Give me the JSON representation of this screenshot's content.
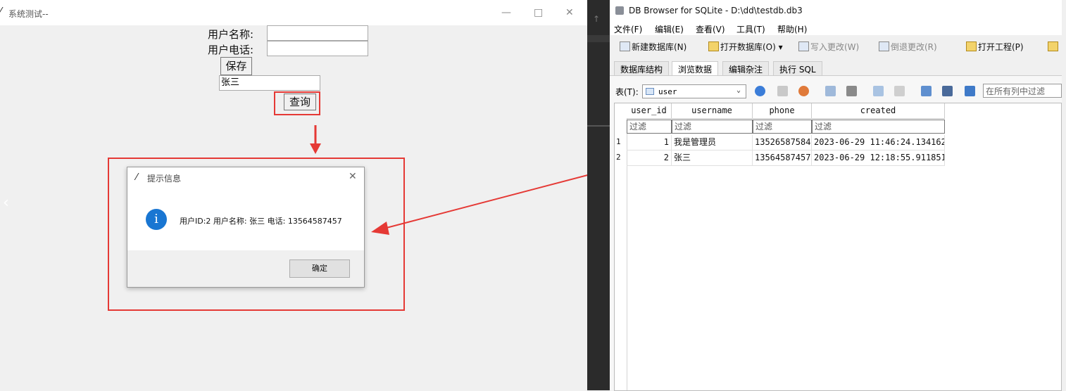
{
  "left_window": {
    "title": "系统测试--",
    "controls": {
      "minimize": "—",
      "maximize": "□",
      "close": "✕"
    },
    "form": {
      "username_label": "用户名称:",
      "phone_label": "用户电话:",
      "save_button": "保存",
      "query_value": "张三",
      "query_button": "查询"
    },
    "dialog": {
      "title": "提示信息",
      "message": "用户ID:2 用户名称: 张三 电话: 13564587457",
      "ok_button": "确定",
      "info_glyph": "i",
      "close": "✕"
    }
  },
  "db_browser": {
    "title": "DB Browser for SQLite - D:\\dd\\testdb.db3",
    "menu": [
      "文件(F)",
      "编辑(E)",
      "查看(V)",
      "工具(T)",
      "帮助(H)"
    ],
    "toolbar": {
      "new_db": "新建数据库(N)",
      "open_db": "打开数据库(O)",
      "write_changes": "写入更改(W)",
      "revert_changes": "倒退更改(R)",
      "open_project": "打开工程(P)"
    },
    "tabs": [
      "数据库结构",
      "浏览数据",
      "编辑杂注",
      "执行 SQL"
    ],
    "table_label": "表(T):",
    "table_name": "user",
    "filter_all_placeholder": "在所有列中过滤",
    "columns": [
      "user_id",
      "username",
      "phone",
      "created"
    ],
    "filter_placeholder": "过滤",
    "rows": [
      {
        "no": "1",
        "user_id": "1",
        "username": "我是管理员",
        "phone": "13526587584",
        "created": "2023-06-29 11:46:24.134162"
      },
      {
        "no": "2",
        "user_id": "2",
        "username": "张三",
        "phone": "13564587457",
        "created": "2023-06-29 12:18:55.911851"
      }
    ]
  },
  "colors": {
    "annotation": "#e53935",
    "info_icon": "#1976d2",
    "editor_bg": "#2b2b2b"
  }
}
